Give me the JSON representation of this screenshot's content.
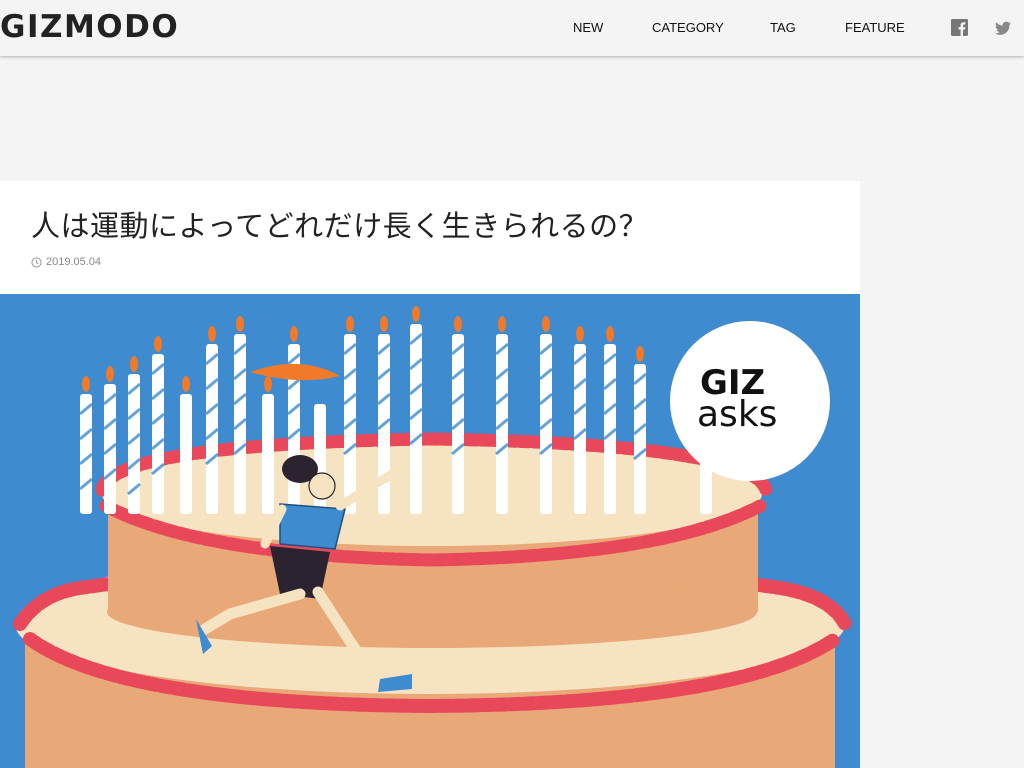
{
  "site": {
    "logo_text": "GIZMODO"
  },
  "nav": {
    "items": [
      "NEW",
      "CATEGORY",
      "TAG",
      "FEATURE"
    ]
  },
  "social": {
    "facebook_icon": "facebook-icon",
    "twitter_icon": "twitter-icon"
  },
  "article": {
    "title": "人は運動によってどれだけ長く生きられるの？",
    "date": "2019.05.04",
    "hero_badge_line1": "GIZ",
    "hero_badge_line2": "asks"
  },
  "colors": {
    "background": "#f4f4f4",
    "hero_sky": "#3e8bd0",
    "cake_frosting": "#e8485a",
    "cake_body": "#e9a877",
    "cake_cream": "#f6e3c2"
  }
}
